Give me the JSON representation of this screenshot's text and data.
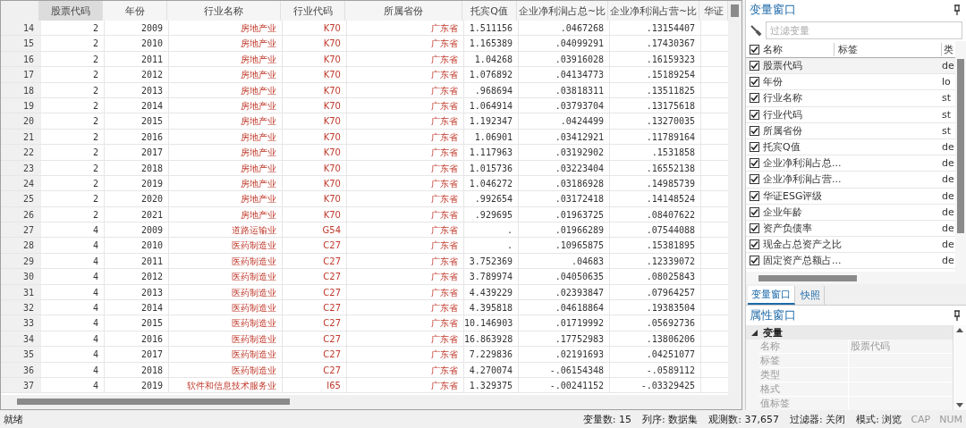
{
  "grid": {
    "columns": [
      {
        "label": "股票代码",
        "kind": "numeric",
        "selected": true
      },
      {
        "label": "年份",
        "kind": "numeric",
        "selected": false
      },
      {
        "label": "行业名称",
        "kind": "string",
        "selected": false
      },
      {
        "label": "行业代码",
        "kind": "string",
        "selected": false
      },
      {
        "label": "所属省份",
        "kind": "string",
        "selected": false
      },
      {
        "label": "托宾Q值",
        "kind": "numeric",
        "selected": false
      },
      {
        "label": "企业净利润占总~比",
        "kind": "numeric",
        "selected": false
      },
      {
        "label": "企业净利润占营~比",
        "kind": "numeric",
        "selected": false
      },
      {
        "label": "华证",
        "selected": false
      }
    ],
    "rows": [
      {
        "id": "14",
        "cells": [
          "2",
          "2009",
          "房地产业",
          "K70",
          "广东省",
          "1.511156",
          ".0467268",
          ".13154407"
        ]
      },
      {
        "id": "15",
        "cells": [
          "2",
          "2010",
          "房地产业",
          "K70",
          "广东省",
          "1.165389",
          ".04099291",
          ".17430367"
        ]
      },
      {
        "id": "16",
        "cells": [
          "2",
          "2011",
          "房地产业",
          "K70",
          "广东省",
          "1.04268",
          ".03916028",
          ".16159323"
        ]
      },
      {
        "id": "17",
        "cells": [
          "2",
          "2012",
          "房地产业",
          "K70",
          "广东省",
          "1.076892",
          ".04134773",
          ".15189254"
        ]
      },
      {
        "id": "18",
        "cells": [
          "2",
          "2013",
          "房地产业",
          "K70",
          "广东省",
          ".968694",
          ".03818311",
          ".13511825"
        ]
      },
      {
        "id": "19",
        "cells": [
          "2",
          "2014",
          "房地产业",
          "K70",
          "广东省",
          "1.064914",
          ".03793704",
          ".13175618"
        ]
      },
      {
        "id": "20",
        "cells": [
          "2",
          "2015",
          "房地产业",
          "K70",
          "广东省",
          "1.192347",
          ".0424499",
          ".13270035"
        ]
      },
      {
        "id": "21",
        "cells": [
          "2",
          "2016",
          "房地产业",
          "K70",
          "广东省",
          "1.06901",
          ".03412921",
          ".11789164"
        ]
      },
      {
        "id": "22",
        "cells": [
          "2",
          "2017",
          "房地产业",
          "K70",
          "广东省",
          "1.117963",
          ".03192902",
          ".1531858"
        ]
      },
      {
        "id": "23",
        "cells": [
          "2",
          "2018",
          "房地产业",
          "K70",
          "广东省",
          "1.015736",
          ".03223404",
          ".16552138"
        ]
      },
      {
        "id": "24",
        "cells": [
          "2",
          "2019",
          "房地产业",
          "K70",
          "广东省",
          "1.046272",
          ".03186928",
          ".14985739"
        ]
      },
      {
        "id": "25",
        "cells": [
          "2",
          "2020",
          "房地产业",
          "K70",
          "广东省",
          ".992654",
          ".03172418",
          ".14148524"
        ]
      },
      {
        "id": "26",
        "cells": [
          "2",
          "2021",
          "房地产业",
          "K70",
          "广东省",
          ".929695",
          ".01963725",
          ".08407622"
        ]
      },
      {
        "id": "27",
        "cells": [
          "4",
          "2009",
          "道路运输业",
          "G54",
          "广东省",
          ".",
          ".01966289",
          ".07544088"
        ]
      },
      {
        "id": "28",
        "cells": [
          "4",
          "2010",
          "医药制造业",
          "C27",
          "广东省",
          ".",
          ".10965875",
          ".15381895"
        ]
      },
      {
        "id": "29",
        "cells": [
          "4",
          "2011",
          "医药制造业",
          "C27",
          "广东省",
          "3.752369",
          ".04683",
          ".12339072"
        ]
      },
      {
        "id": "30",
        "cells": [
          "4",
          "2012",
          "医药制造业",
          "C27",
          "广东省",
          "3.789974",
          ".04050635",
          ".08025843"
        ]
      },
      {
        "id": "31",
        "cells": [
          "4",
          "2013",
          "医药制造业",
          "C27",
          "广东省",
          "4.439229",
          ".02393847",
          ".07964257"
        ]
      },
      {
        "id": "32",
        "cells": [
          "4",
          "2014",
          "医药制造业",
          "C27",
          "广东省",
          "4.395818",
          ".04618864",
          ".19383504"
        ]
      },
      {
        "id": "33",
        "cells": [
          "4",
          "2015",
          "医药制造业",
          "C27",
          "广东省",
          "10.146903",
          ".01719992",
          ".05692736"
        ]
      },
      {
        "id": "34",
        "cells": [
          "4",
          "2016",
          "医药制造业",
          "C27",
          "广东省",
          "16.863928",
          ".17752983",
          ".13806206"
        ]
      },
      {
        "id": "35",
        "cells": [
          "4",
          "2017",
          "医药制造业",
          "C27",
          "广东省",
          "7.229836",
          ".02191693",
          ".04251077"
        ]
      },
      {
        "id": "36",
        "cells": [
          "4",
          "2018",
          "医药制造业",
          "C27",
          "广东省",
          "4.270074",
          "-.06154348",
          "-.0589112"
        ]
      },
      {
        "id": "37",
        "cells": [
          "4",
          "2019",
          "软件和信息技术服务业",
          "I65",
          "广东省",
          "1.329375",
          "-.00241152",
          "-.03329425"
        ]
      }
    ]
  },
  "variables_window": {
    "title": "变量窗口",
    "filter": {
      "placeholder": "过滤变量"
    },
    "columns": [
      "名称",
      "标签",
      "类"
    ],
    "all_checked": true,
    "variables": [
      {
        "name": "股票代码",
        "type": "de",
        "checked": true,
        "selected": true
      },
      {
        "name": "年份",
        "type": "lo",
        "checked": true,
        "selected": false
      },
      {
        "name": "行业名称",
        "type": "st",
        "checked": true,
        "selected": false
      },
      {
        "name": "行业代码",
        "type": "st",
        "checked": true,
        "selected": false
      },
      {
        "name": "所属省份",
        "type": "st",
        "checked": true,
        "selected": false
      },
      {
        "name": "托宾Q值",
        "type": "de",
        "checked": true,
        "selected": false
      },
      {
        "name": "企业净利润占总...",
        "type": "de",
        "checked": true,
        "selected": false
      },
      {
        "name": "企业净利润占营...",
        "type": "de",
        "checked": true,
        "selected": false
      },
      {
        "name": "华证ESG评级",
        "type": "de",
        "checked": true,
        "selected": false
      },
      {
        "name": "企业年龄",
        "type": "de",
        "checked": true,
        "selected": false
      },
      {
        "name": "资产负债率",
        "type": "de",
        "checked": true,
        "selected": false
      },
      {
        "name": "现金占总资产之比",
        "type": "de",
        "checked": true,
        "selected": false
      },
      {
        "name": "固定资产总额占...",
        "type": "de",
        "checked": true,
        "selected": false
      }
    ]
  },
  "panel_tabs": [
    {
      "label": "变量窗口",
      "selected": true
    },
    {
      "label": "快照",
      "selected": false
    }
  ],
  "properties_window": {
    "title": "属性窗口",
    "section": "变量",
    "expanded": true,
    "properties": [
      {
        "name": "名称",
        "value": "股票代码"
      },
      {
        "name": "标签"
      },
      {
        "name": "类型"
      },
      {
        "name": "格式"
      },
      {
        "name": "值标签"
      }
    ]
  },
  "status_bar": {
    "message": "就绪",
    "items": [
      {
        "label": "变量数:",
        "value": "15"
      },
      {
        "label": "列序:",
        "value": "数据集"
      },
      {
        "label": "观测数:",
        "value": "37,657"
      },
      {
        "label": "过滤器:",
        "value": "关闭"
      },
      {
        "label": "模式:",
        "value": "浏览"
      }
    ],
    "indicators": [
      {
        "label": "CAP",
        "on": false
      },
      {
        "label": "NUM",
        "on": false
      }
    ]
  }
}
